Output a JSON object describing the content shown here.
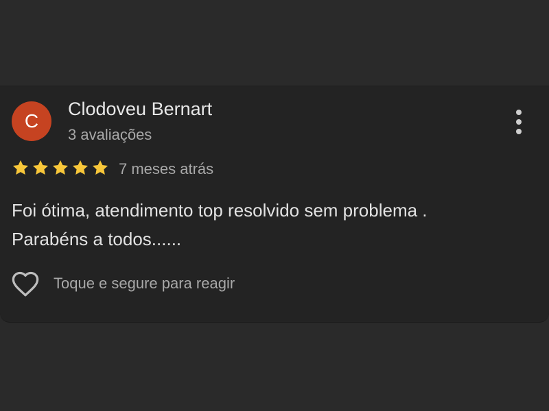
{
  "review": {
    "author": {
      "initial": "C",
      "name": "Clodoveu Bernart",
      "review_count_text": "3 avaliações",
      "avatar_color": "#c64321"
    },
    "rating": 5,
    "rating_max": 5,
    "star_color": "#f8c73a",
    "time_ago": "7 meses atrás",
    "text_line_1": "Foi ótima, atendimento top resolvido sem problema .",
    "text_line_2": "Parabéns a todos......",
    "react_label": "Toque e segure para reagir",
    "icons": {
      "more": "more-vert-icon",
      "react": "heart-outline-icon",
      "star": "star-icon"
    }
  }
}
